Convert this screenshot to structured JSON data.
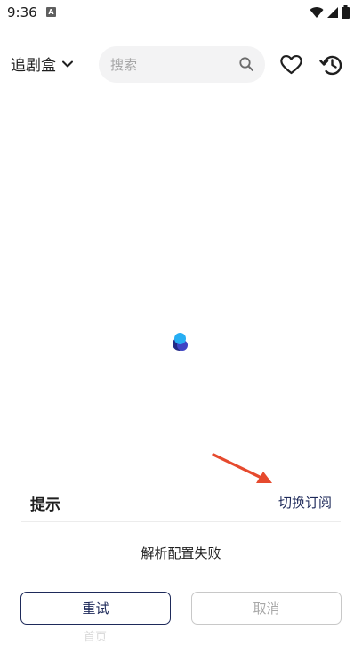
{
  "status_bar": {
    "time": "9:36",
    "notification_badge": "A",
    "icons": [
      "wifi-icon",
      "signal-icon",
      "battery-icon"
    ]
  },
  "header": {
    "source_title": "追剧盒",
    "search_placeholder": "搜索",
    "icons": [
      "chevron-down-icon",
      "search-icon",
      "heart-icon",
      "history-icon"
    ]
  },
  "dialog": {
    "title": "提示",
    "switch_label": "切换订阅",
    "message": "解析配置失败",
    "retry_label": "重试",
    "cancel_label": "取消"
  },
  "background": {
    "obscured_text": "首页"
  },
  "colors": {
    "accent": "#1e2a5a",
    "arrow": "#e64a2e",
    "loader_primary": "#27aef3",
    "loader_secondary": "#232a86"
  }
}
